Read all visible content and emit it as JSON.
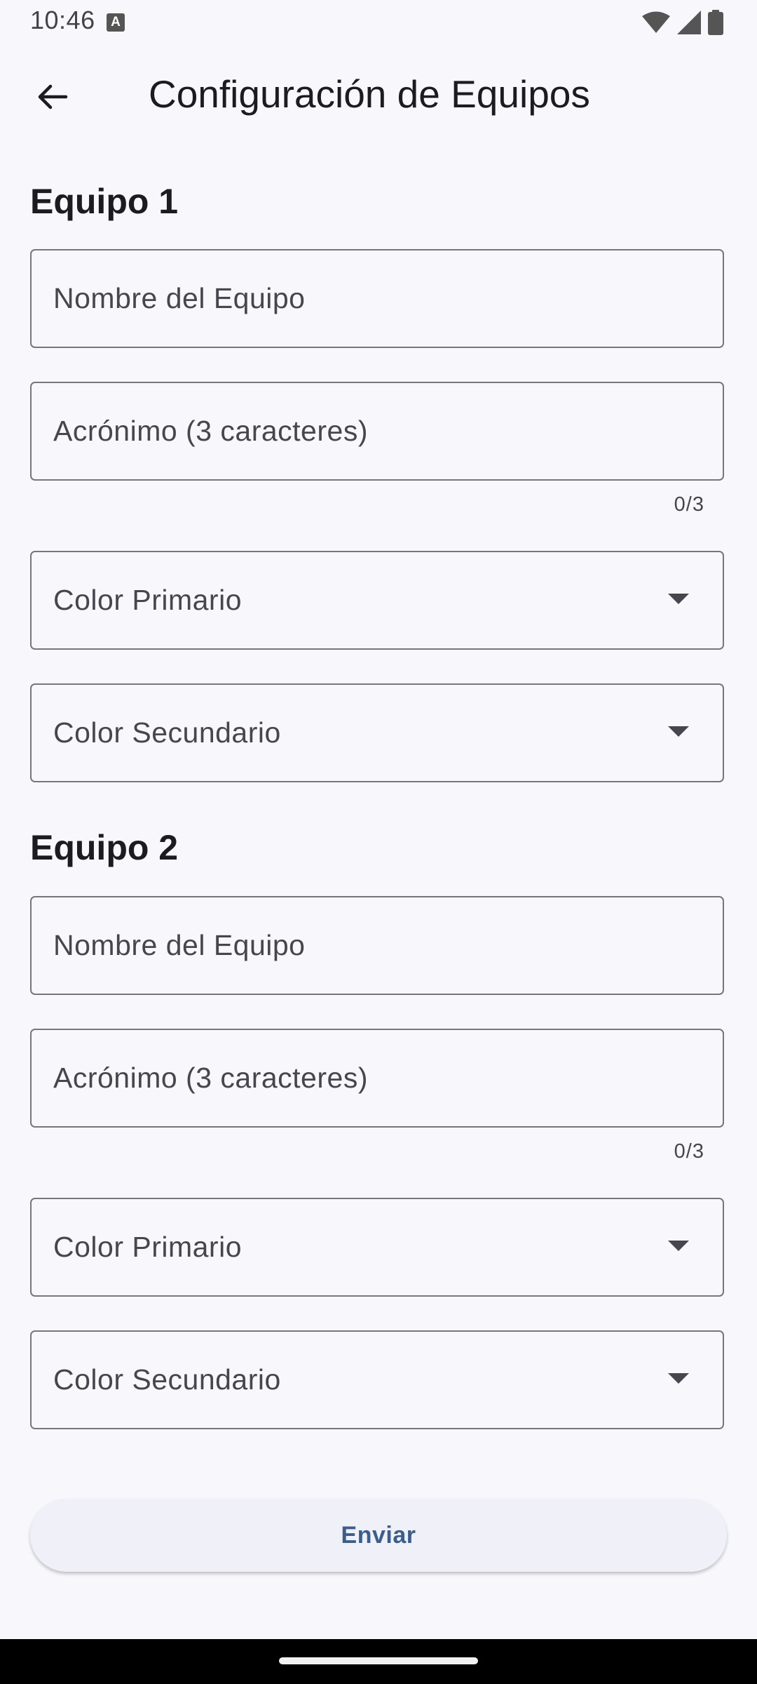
{
  "status_bar": {
    "time": "10:46",
    "notification_glyph": "A",
    "icons": [
      "wifi-icon",
      "signal-icon",
      "battery-icon"
    ]
  },
  "app_bar": {
    "title": "Configuración de Equipos",
    "back_icon": "arrow-back-icon"
  },
  "teams": [
    {
      "title": "Equipo 1",
      "name_label": "Nombre del Equipo",
      "acronym_label": "Acrónimo (3 caracteres)",
      "acronym_counter": "0/3",
      "primary_color_label": "Color Primario",
      "secondary_color_label": "Color Secundario"
    },
    {
      "title": "Equipo 2",
      "name_label": "Nombre del Equipo",
      "acronym_label": "Acrónimo (3 caracteres)",
      "acronym_counter": "0/3",
      "primary_color_label": "Color Primario",
      "secondary_color_label": "Color Secundario"
    }
  ],
  "submit": {
    "label": "Enviar"
  },
  "colors": {
    "background": "#f7f7fc",
    "outline": "#79747e",
    "button_text": "#3b5f8a",
    "button_surface": "#f0f1f8"
  }
}
